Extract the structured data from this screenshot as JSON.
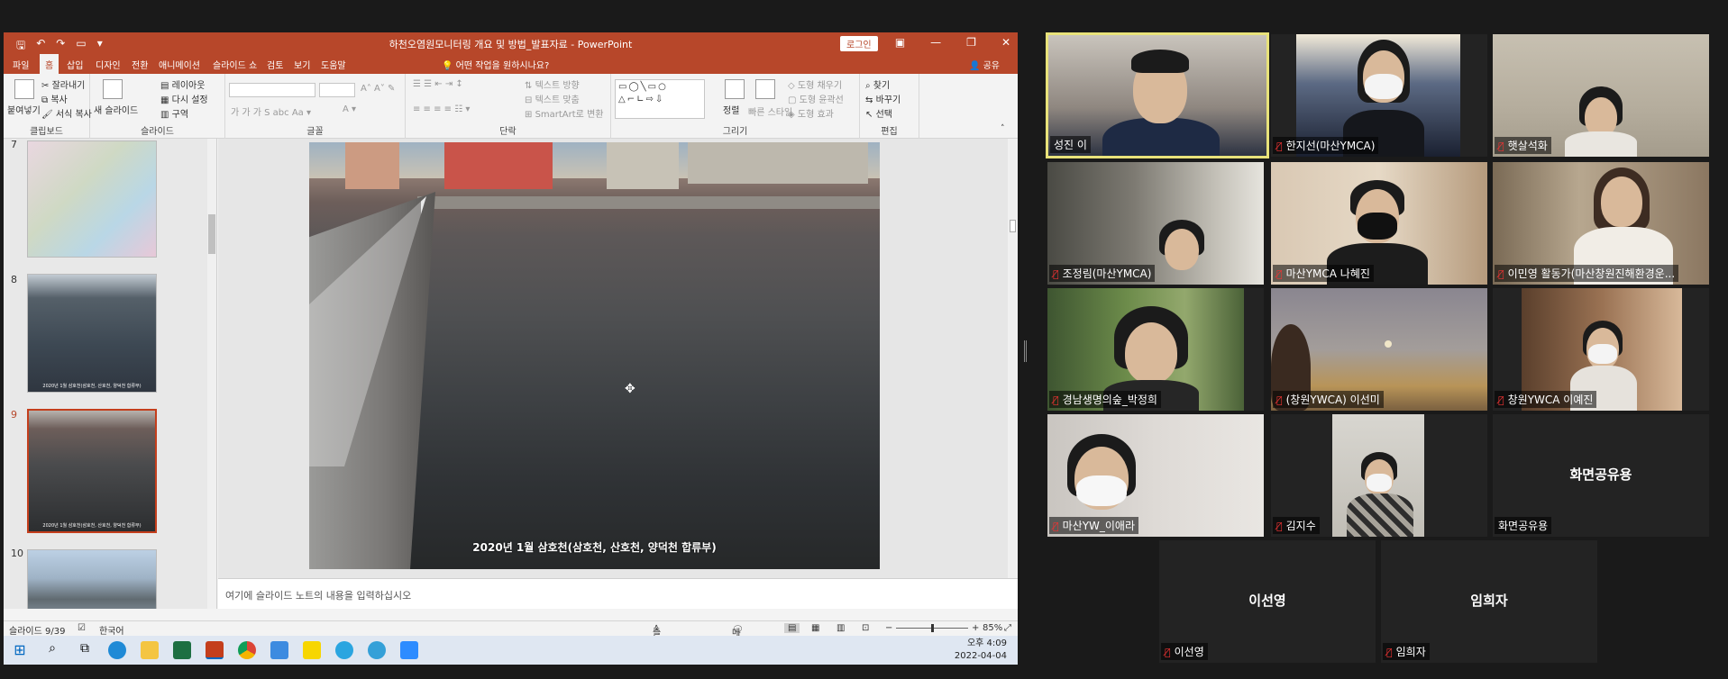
{
  "ppt": {
    "title": "하천오염원모니터링 개요 및 방법_발표자료  -  PowerPoint",
    "login_label": "로그인",
    "tabs": [
      "파일",
      "홈",
      "삽입",
      "디자인",
      "전환",
      "애니메이션",
      "슬라이드 쇼",
      "검토",
      "보기",
      "도움말"
    ],
    "tell_me": "어떤 작업을 원하시나요?",
    "share": "공유",
    "ribbon": {
      "clipboard": {
        "label": "클립보드",
        "paste": "붙여넣기",
        "cut": "잘라내기",
        "copy": "복사",
        "format_painter": "서식 복사"
      },
      "slides": {
        "label": "슬라이드",
        "new_slide": "새 슬라이드",
        "layout": "레이아웃",
        "reset": "다시 설정",
        "section": "구역"
      },
      "font": {
        "label": "글꼴"
      },
      "paragraph": {
        "label": "단락",
        "text_direction": "텍스트 방향",
        "align_text": "텍스트 맞춤",
        "smartart": "SmartArt로 변환"
      },
      "drawing": {
        "label": "그리기",
        "arrange": "정렬",
        "quick_styles": "빠른 스타일",
        "shape_fill": "도형 채우기",
        "shape_outline": "도형 윤곽선",
        "shape_effects": "도형 효과"
      },
      "editing": {
        "label": "편집",
        "find": "찾기",
        "replace": "바꾸기",
        "select": "선택"
      }
    },
    "thumbnails": [
      {
        "num": "7",
        "caption": ""
      },
      {
        "num": "8",
        "caption": "2020년 1월 삼호천(삼호천, 산호천, 양덕천 합류부)"
      },
      {
        "num": "9",
        "caption": "2020년 1월 삼호천(삼호천, 산호천, 양덕천 합류부)"
      },
      {
        "num": "10",
        "caption": ""
      }
    ],
    "slide_caption": "2020년 1월 삼호천(삼호천, 산호천, 양덕천 합류부)",
    "notes_placeholder": "여기에 슬라이드 노트의 내용을 입력하십시오",
    "status": {
      "slide_count": "슬라이드 9/39",
      "language": "한국어",
      "notes_btn": "슬라이드 노트",
      "comments_btn": "메모",
      "zoom": "85%",
      "zoom_fraction": 0.5
    },
    "clock": {
      "time": "오후 4:09",
      "date": "2022-04-04"
    }
  },
  "participants": [
    {
      "name": "성진 이",
      "speaking": true,
      "muted": false,
      "video": true
    },
    {
      "name": "한지선(마산YMCA)",
      "speaking": false,
      "muted": true,
      "video": true
    },
    {
      "name": "햇살석화",
      "speaking": false,
      "muted": true,
      "video": true
    },
    {
      "name": "조정림(마산YMCA)",
      "speaking": false,
      "muted": true,
      "video": true
    },
    {
      "name": "마산YMCA 나혜진",
      "speaking": false,
      "muted": true,
      "video": true
    },
    {
      "name": "이민영 활동가(마산창원진해환경운...",
      "speaking": false,
      "muted": true,
      "video": true
    },
    {
      "name": "경남생명의숲_박정희",
      "speaking": false,
      "muted": true,
      "video": true
    },
    {
      "name": "(창원YWCA) 이선미",
      "speaking": false,
      "muted": true,
      "video": true
    },
    {
      "name": "창원YWCA 이예진",
      "speaking": false,
      "muted": true,
      "video": true
    },
    {
      "name": "마산YW_이애라",
      "speaking": false,
      "muted": true,
      "video": true
    },
    {
      "name": "김지수",
      "speaking": false,
      "muted": true,
      "video": true
    },
    {
      "name": "화면공유용",
      "speaking": false,
      "muted": false,
      "video": false,
      "display": "화면공유용"
    },
    {
      "name": "이선영",
      "speaking": false,
      "muted": true,
      "video": false,
      "display": "이선영"
    },
    {
      "name": "임희자",
      "speaking": false,
      "muted": true,
      "video": false,
      "display": "임희자"
    }
  ],
  "colors": {
    "ppt_accent": "#b7472a",
    "speaking_border": "#e8e27a",
    "muted_icon": "#e33333"
  }
}
